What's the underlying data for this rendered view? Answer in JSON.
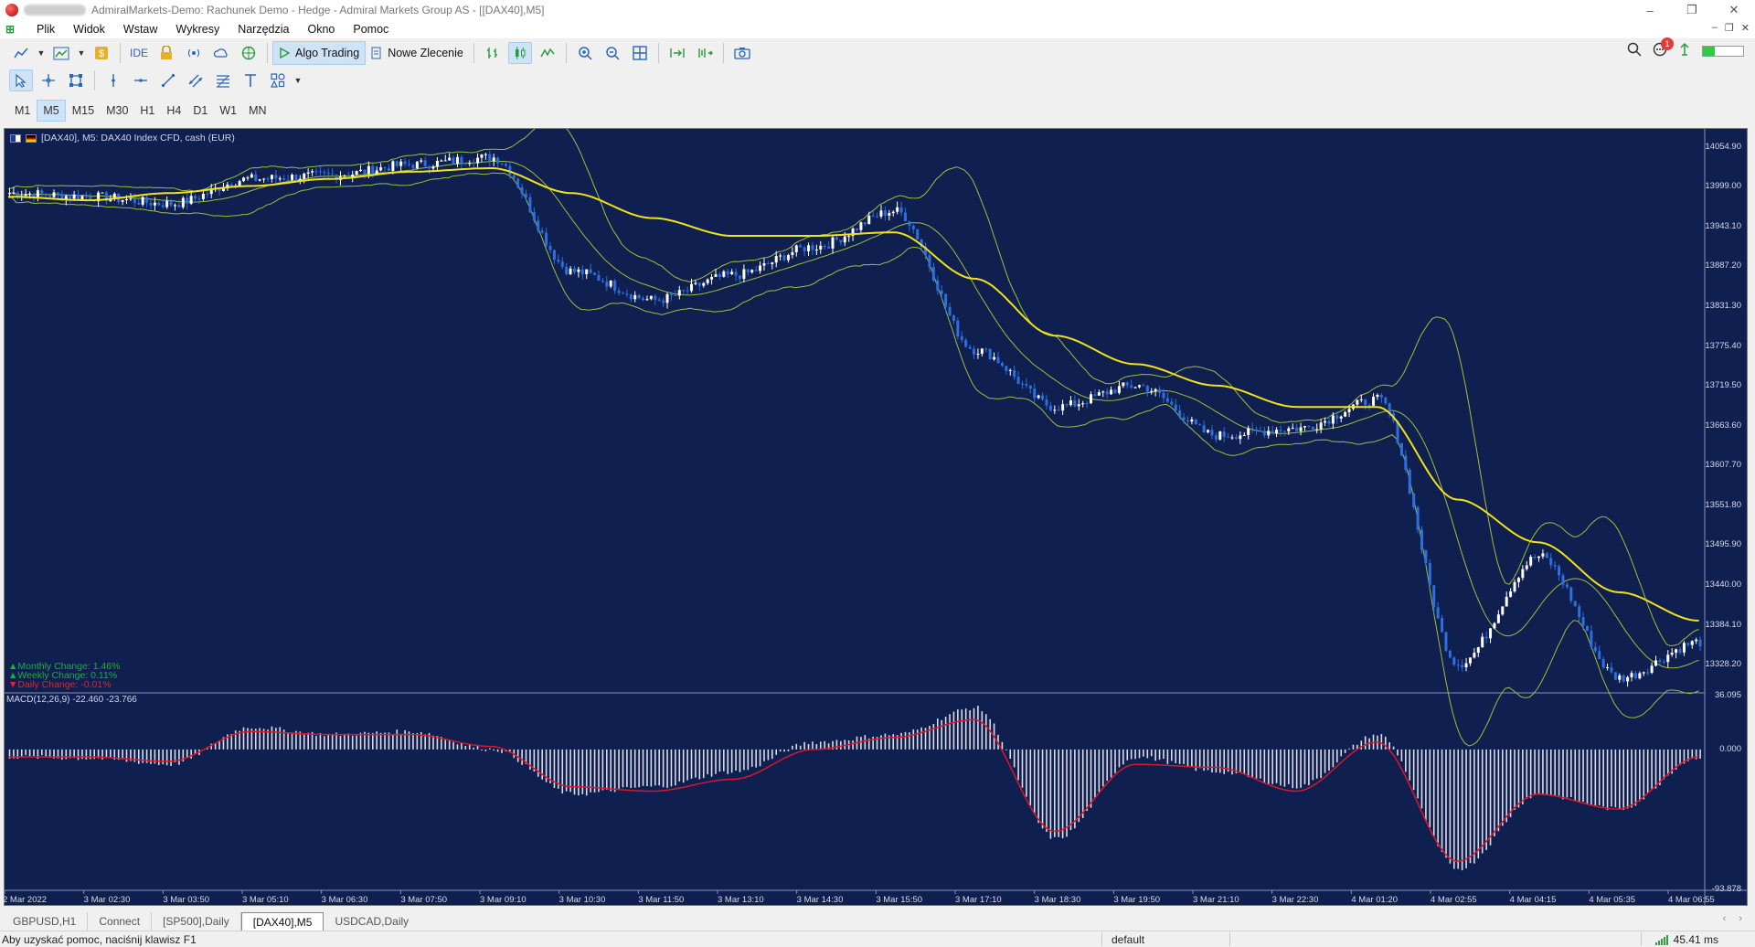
{
  "window": {
    "title": "AdmiralMarkets-Demo: Rachunek Demo - Hedge - Admiral Markets Group AS - [[DAX40],M5]",
    "minimize": "–",
    "restore": "❐",
    "close": "✕"
  },
  "menu": {
    "items": [
      "Plik",
      "Widok",
      "Wstaw",
      "Wykresy",
      "Narzędzia",
      "Okno",
      "Pomoc"
    ],
    "mdi_minimize": "–",
    "mdi_restore": "❐",
    "mdi_close": "✕"
  },
  "toolbar": {
    "ide_label": "IDE",
    "algo_trading_label": "Algo Trading",
    "new_order_label": "Nowe Zlecenie",
    "notification_count": "1",
    "signal_level": 0.3
  },
  "timeframes": {
    "items": [
      "M1",
      "M5",
      "M15",
      "M30",
      "H1",
      "H4",
      "D1",
      "W1",
      "MN"
    ],
    "active": "M5"
  },
  "chart": {
    "header": "[DAX40], M5:  DAX40 Index CFD, cash (EUR)",
    "monthly_change": "▲Monthly Change: 1.46%",
    "weekly_change": "▲Weekly Change: 0.11%",
    "daily_change": "▼Daily Change: -0.01%",
    "macd_label": "MACD(12,26,9) -22.460 -23.766",
    "colors": {
      "background": "#0f1f4f",
      "bull_candle": "#ffffff",
      "bear_candle": "#2e6fe0",
      "ma": "#f2e21a",
      "bollinger": "#9fbf3a",
      "macd_hist": "#dcdce6",
      "macd_signal": "#d8182a"
    },
    "price_labels": [
      "14054.90",
      "13999.00",
      "13943.10",
      "13887.20",
      "13831.30",
      "13775.40",
      "13719.50",
      "13663.60",
      "13607.70",
      "13551.80",
      "13495.90",
      "13440.00",
      "13384.10",
      "13328.20"
    ],
    "macd_labels": [
      "36.095",
      "0.000",
      "-93.878"
    ],
    "time_labels": [
      "2 Mar 2022",
      "3 Mar 02:30",
      "3 Mar 03:50",
      "3 Mar 05:10",
      "3 Mar 06:30",
      "3 Mar 07:50",
      "3 Mar 09:10",
      "3 Mar 10:30",
      "3 Mar 11:50",
      "3 Mar 13:10",
      "3 Mar 14:30",
      "3 Mar 15:50",
      "3 Mar 17:10",
      "3 Mar 18:30",
      "3 Mar 19:50",
      "3 Mar 21:10",
      "3 Mar 22:30",
      "4 Mar 01:20",
      "4 Mar 02:55",
      "4 Mar 04:15",
      "4 Mar 05:35",
      "4 Mar 06:55"
    ]
  },
  "chart_data": {
    "type": "line",
    "title": "[DAX40], M5:  DAX40 Index CFD, cash (EUR)",
    "xlabel": "",
    "ylabel": "",
    "ylim": [
      13290,
      14075
    ],
    "x": [
      "2 Mar 2022",
      "3 Mar 02:30",
      "3 Mar 03:50",
      "3 Mar 05:10",
      "3 Mar 06:30",
      "3 Mar 07:50",
      "3 Mar 09:10",
      "3 Mar 10:30",
      "3 Mar 11:50",
      "3 Mar 13:10",
      "3 Mar 14:30",
      "3 Mar 15:50",
      "3 Mar 17:10",
      "3 Mar 18:30",
      "3 Mar 19:50",
      "3 Mar 21:10",
      "3 Mar 22:30",
      "4 Mar 01:20",
      "4 Mar 02:55",
      "4 Mar 04:15",
      "4 Mar 05:35",
      "4 Mar 06:55"
    ],
    "series": [
      {
        "values": [
          13990,
          13985,
          13975,
          14010,
          14015,
          14030,
          14040,
          13880,
          13840,
          13875,
          13915,
          13965,
          13770,
          13690,
          13720,
          13650,
          13660,
          13700,
          13330,
          13480,
          13310,
          13360
        ]
      },
      {
        "values": [
          13985,
          13980,
          13990,
          14000,
          14010,
          14020,
          14025,
          13990,
          13955,
          13930,
          13930,
          13935,
          13870,
          13790,
          13750,
          13720,
          13690,
          13690,
          13560,
          13500,
          13430,
          13390
        ]
      }
    ],
    "macd": {
      "ylim": [
        -93.878,
        36.095
      ],
      "histogram": [
        -5,
        -6,
        -10,
        15,
        10,
        12,
        0,
        -30,
        -25,
        -15,
        5,
        10,
        28,
        -60,
        -5,
        -15,
        -25,
        10,
        -80,
        -30,
        -40,
        -5
      ],
      "signal": [
        -5,
        -5,
        -8,
        12,
        10,
        10,
        2,
        -25,
        -28,
        -20,
        0,
        8,
        20,
        -55,
        -10,
        -12,
        -28,
        5,
        -75,
        -30,
        -40,
        -5
      ]
    }
  },
  "tabs": {
    "items": [
      "GBPUSD,H1",
      "Connect",
      "[SP500],Daily",
      "[DAX40],M5",
      "USDCAD,Daily"
    ],
    "active": "[DAX40],M5"
  },
  "status": {
    "help": "Aby uzyskać pomoc, naciśnij klawisz F1",
    "profile": "default",
    "ping": "45.41 ms"
  }
}
